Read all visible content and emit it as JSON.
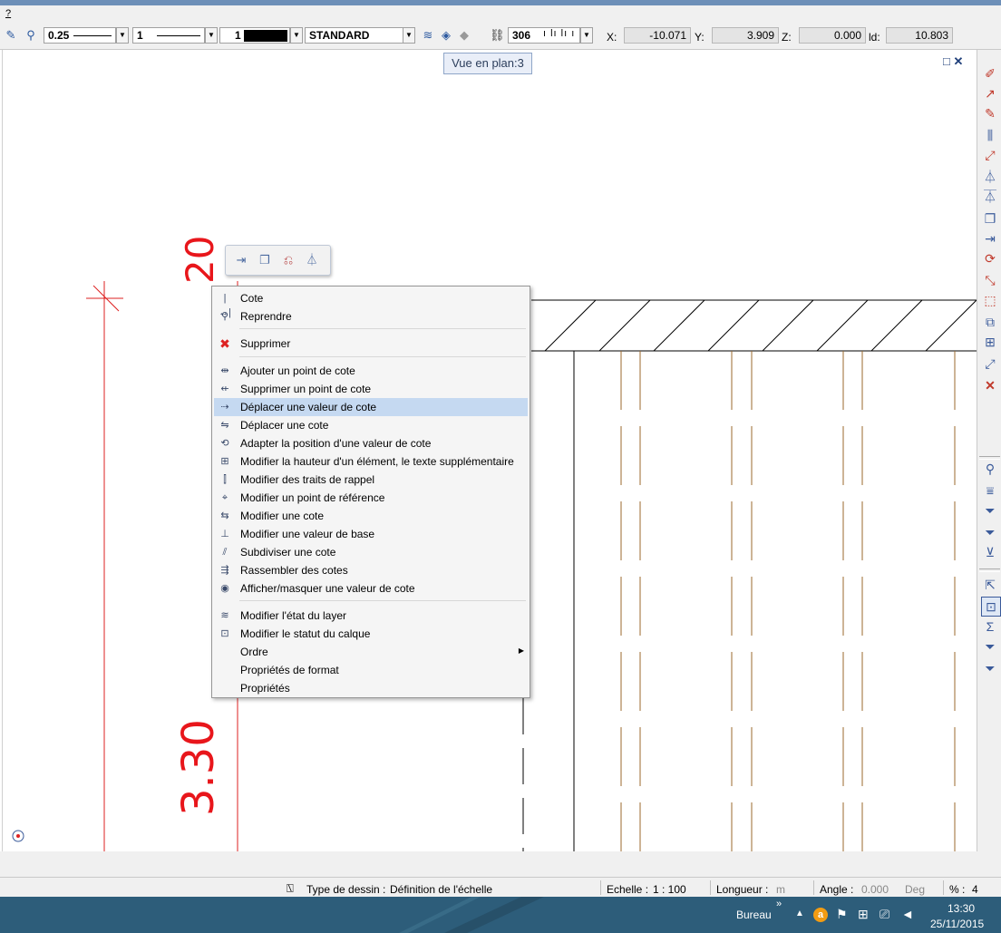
{
  "menubar": {
    "help": "?"
  },
  "toolbar": {
    "pen_thickness": "0.25",
    "line_type": "1",
    "color_number": "1",
    "layer_name": "STANDARD",
    "level_value": "306",
    "coords": {
      "x_label": "X:",
      "x_value": "-10.071",
      "y_label": "Y:",
      "y_value": "3.909",
      "z_label": "Z:",
      "z_value": "0.000",
      "d_label": "ld:",
      "d_value": "10.803"
    }
  },
  "view": {
    "tooltip": "Vue en plan:3"
  },
  "annotations": {
    "top": "20",
    "side": "3.30"
  },
  "context_menu": {
    "group1": [
      {
        "label": "Cote",
        "icon": "dimension-icon"
      },
      {
        "label": "Reprendre",
        "icon": "eyedropper-icon"
      }
    ],
    "group2": [
      {
        "label": "Supprimer",
        "icon": "delete-icon"
      }
    ],
    "group3": [
      {
        "label": "Ajouter un point de cote",
        "icon": "add-dim-point-icon"
      },
      {
        "label": "Supprimer un point de cote",
        "icon": "remove-dim-point-icon"
      },
      {
        "label": "Déplacer une valeur de cote",
        "icon": "move-dim-value-icon",
        "highlighted": true
      },
      {
        "label": "Déplacer une cote",
        "icon": "move-dimension-icon"
      },
      {
        "label": "Adapter la position d'une valeur de cote",
        "icon": "adapt-position-icon"
      },
      {
        "label": "Modifier la hauteur d'un élément, le texte supplémentaire",
        "icon": "modify-height-icon"
      },
      {
        "label": "Modifier des traits de rappel",
        "icon": "extension-lines-icon"
      },
      {
        "label": "Modifier un point de référence",
        "icon": "reference-point-icon"
      },
      {
        "label": "Modifier une cote",
        "icon": "modify-dimension-icon"
      },
      {
        "label": "Modifier une valeur de base",
        "icon": "base-value-icon"
      },
      {
        "label": "Subdiviser une cote",
        "icon": "subdivide-icon"
      },
      {
        "label": "Rassembler des cotes",
        "icon": "merge-icon"
      },
      {
        "label": "Afficher/masquer une valeur de cote",
        "icon": "show-hide-icon"
      }
    ],
    "group4": [
      {
        "label": "Modifier l'état du layer",
        "icon": "layer-state-icon"
      },
      {
        "label": "Modifier le statut du calque",
        "icon": "layer-status-icon"
      },
      {
        "label": "Ordre",
        "icon": "",
        "submenu": true
      },
      {
        "label": "Propriétés de format",
        "icon": ""
      },
      {
        "label": "Propriétés",
        "icon": ""
      }
    ]
  },
  "statusbar": {
    "drawing_type_label": "Type de dessin :",
    "drawing_type_value": "Définition de l'échelle",
    "scale_label": "Echelle :",
    "scale_value": "1 : 100",
    "length_label": "Longueur :",
    "length_unit": "m",
    "angle_label": "Angle :",
    "angle_value": "0.000",
    "angle_unit": "Deg",
    "percent_label": "% :",
    "percent_value": "4"
  },
  "taskbar": {
    "desktop": "Bureau",
    "chevron": "»",
    "time": "13:30",
    "date": "25/11/2015"
  },
  "colors": {
    "accent": "#c5d9f1",
    "annotation": "#e8161b",
    "taskbar": "#2d5d7a"
  }
}
